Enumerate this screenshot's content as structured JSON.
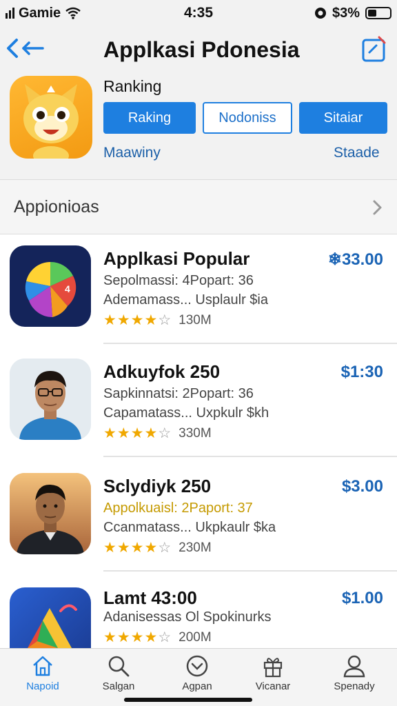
{
  "status_bar": {
    "carrier": "Gamie",
    "time": "4:35",
    "battery_text": "$3%"
  },
  "header": {
    "title": "Applkasi Pdonesia",
    "section_label": "Ranking",
    "buttons": [
      {
        "label": "Raking",
        "style": "primary"
      },
      {
        "label": "Nodoniss",
        "style": "outline"
      },
      {
        "label": "Sitaiar",
        "style": "primary"
      }
    ],
    "link_left": "Maawiny",
    "link_right": "Staade"
  },
  "category": {
    "label": "Appionioas"
  },
  "apps": [
    {
      "title": "Applkasi  Popular",
      "price": "❄33.00",
      "line1": "Sepolmassi: 4Popart: 36",
      "line2": "Ademamass... Usplaulr $ia",
      "stars": 4,
      "rating_count": "130M",
      "icon": "pie-chart-icon"
    },
    {
      "title": "Adkuyfok 250",
      "price": "$1:30",
      "line1": "Sapkinnatsi: 2Popart: 36",
      "line2": "Capamatass... Uxpkulr $kh",
      "stars": 4.5,
      "rating_count": "330M",
      "icon": "person-glasses-photo"
    },
    {
      "title": "Sclydiyk 250",
      "price": "$3.00",
      "line1": "Appolkuaisl: 2Paport: 37",
      "line2": "Ccanmatass... Ukpkaulr $ka",
      "stars": 4.5,
      "rating_count": "230M",
      "icon": "person-photo"
    },
    {
      "title": "Lamt 43:00",
      "price": "$1.00",
      "line1": "Adanisessas Ol Spokinurks",
      "line2": "",
      "stars": 4.5,
      "rating_count": "200M",
      "icon": "triangle-logo-icon"
    }
  ],
  "tab_bar": [
    {
      "label": "Napoid",
      "icon": "home-icon",
      "active": true
    },
    {
      "label": "Salgan",
      "icon": "search-icon",
      "active": false
    },
    {
      "label": "Agpan",
      "icon": "chevron-circle-icon",
      "active": false
    },
    {
      "label": "Vicanar",
      "icon": "gift-icon",
      "active": false
    },
    {
      "label": "Spenady",
      "icon": "profile-icon",
      "active": false
    }
  ],
  "colors": {
    "accent": "#1e7fe0",
    "price": "#1b64b5",
    "star": "#f0a800"
  }
}
